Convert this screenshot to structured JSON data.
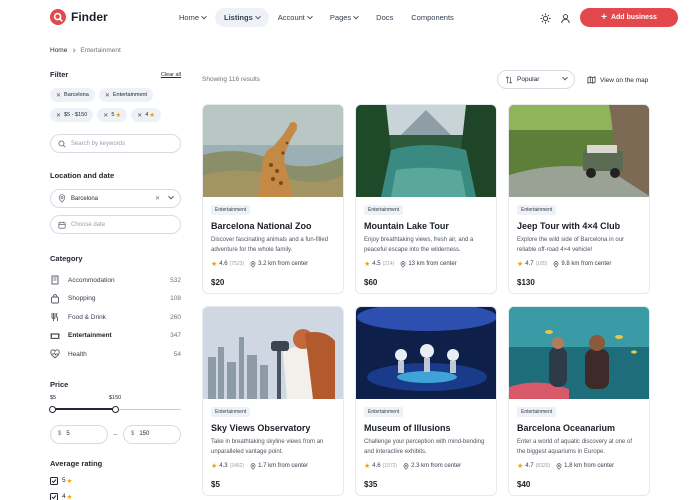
{
  "brand": {
    "name": "Finder",
    "accent": "#e2484c"
  },
  "nav": [
    {
      "label": "Home",
      "dropdown": true,
      "active": false
    },
    {
      "label": "Listings",
      "dropdown": true,
      "active": true
    },
    {
      "label": "Account",
      "dropdown": true,
      "active": false
    },
    {
      "label": "Pages",
      "dropdown": true,
      "active": false
    },
    {
      "label": "Docs",
      "dropdown": false,
      "active": false
    },
    {
      "label": "Components",
      "dropdown": false,
      "active": false
    }
  ],
  "header": {
    "add_business_label": "Add business",
    "theme_icon": "sun-icon",
    "account_icon": "user-icon"
  },
  "breadcrumb": {
    "home": "Home",
    "current": "Entertainment"
  },
  "filter": {
    "title": "Filter",
    "clear_all": "Clear all",
    "tags": [
      {
        "label": "Barcelona",
        "star": false
      },
      {
        "label": "Entertainment",
        "star": false
      },
      {
        "label": "$5 - $150",
        "star": false
      },
      {
        "label": "5",
        "star": true
      },
      {
        "label": "4",
        "star": true
      }
    ],
    "search_placeholder": "Search by keywords"
  },
  "location": {
    "title": "Location and date",
    "city": "Barcelona",
    "date_placeholder": "Choose date"
  },
  "category": {
    "title": "Category",
    "items": [
      {
        "name": "Accommodation",
        "count": "532",
        "icon": "building-icon",
        "active": false
      },
      {
        "name": "Shopping",
        "count": "108",
        "icon": "shopping-bag-icon",
        "active": false
      },
      {
        "name": "Food & Drink",
        "count": "260",
        "icon": "food-icon",
        "active": false
      },
      {
        "name": "Entertainment",
        "count": "347",
        "icon": "ticket-icon",
        "active": true
      },
      {
        "name": "Health",
        "count": "54",
        "icon": "heart-pulse-icon",
        "active": false
      }
    ]
  },
  "price": {
    "title": "Price",
    "min_label": "$5",
    "max_label": "$150",
    "min_value": "5",
    "max_value": "150",
    "range_min": 5,
    "range_max": 300
  },
  "rating": {
    "title": "Average rating",
    "options": [
      {
        "value": "5",
        "checked": true
      },
      {
        "value": "4",
        "checked": true
      }
    ]
  },
  "results": {
    "text": "Showing 116 results",
    "sort_label": "Popular",
    "map_label": "View on the map"
  },
  "listings": [
    {
      "badge": "Entertainment",
      "title": "Barcelona National Zoo",
      "desc": "Discover fascinating animals and a fun-filled adventure for the whole family.",
      "rating": "4.6",
      "reviews": "(7523)",
      "distance": "3.2 km from center",
      "price": "$20",
      "image": "giraffe"
    },
    {
      "badge": "Entertainment",
      "title": "Mountain Lake Tour",
      "desc": "Enjoy breathtaking views, fresh air, and a peaceful escape into the wilderness.",
      "rating": "4.5",
      "reviews": "(214)",
      "distance": "13 km from center",
      "price": "$60",
      "image": "lake"
    },
    {
      "badge": "Entertainment",
      "title": "Jeep Tour with 4×4 Club",
      "desc": "Explore the wild side of Barcelona in our reliable off-road 4×4 vehicle!",
      "rating": "4.7",
      "reviews": "(185)",
      "distance": "9.8 km from center",
      "price": "$130",
      "image": "jeep"
    },
    {
      "badge": "Entertainment",
      "title": "Sky Views Observatory",
      "desc": "Take in breathtaking skyline views from an unparalleled vantage point.",
      "rating": "4.3",
      "reviews": "(3462)",
      "distance": "1.7 km from center",
      "price": "$5",
      "image": "skyline"
    },
    {
      "badge": "Entertainment",
      "title": "Museum of Illusions",
      "desc": "Challenge your perception with mind-bending and interactive exhibits.",
      "rating": "4.6",
      "reviews": "(1572)",
      "distance": "2.3 km from center",
      "price": "$35",
      "image": "museum"
    },
    {
      "badge": "Entertainment",
      "title": "Barcelona Oceanarium",
      "desc": "Enter a world of aquatic discovery at one of the biggest aquariums in Europe.",
      "rating": "4.7",
      "reviews": "(8325)",
      "distance": "1.8 km from center",
      "price": "$40",
      "image": "aquarium"
    }
  ]
}
